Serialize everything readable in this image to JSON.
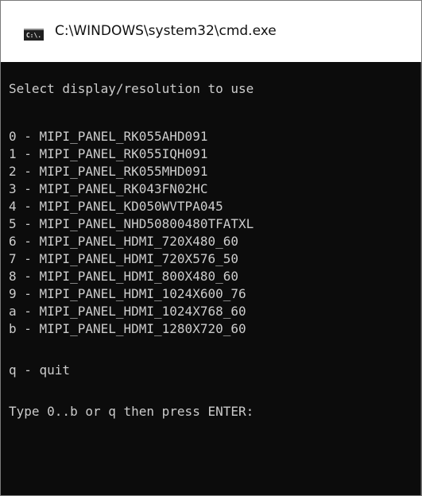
{
  "window": {
    "title": "C:\\WINDOWS\\system32\\cmd.exe",
    "icon": "cmd-icon",
    "icon_text": "C:\\."
  },
  "console": {
    "prompt_heading": "Select display/resolution to use",
    "options": [
      "0 - MIPI_PANEL_RK055AHD091",
      "1 - MIPI_PANEL_RK055IQH091",
      "2 - MIPI_PANEL_RK055MHD091",
      "3 - MIPI_PANEL_RK043FN02HC",
      "4 - MIPI_PANEL_KD050WVTPA045",
      "5 - MIPI_PANEL_NHD50800480TFATXL",
      "6 - MIPI_PANEL_HDMI_720X480_60",
      "7 - MIPI_PANEL_HDMI_720X576_50",
      "8 - MIPI_PANEL_HDMI_800X480_60",
      "9 - MIPI_PANEL_HDMI_1024X600_76",
      "a - MIPI_PANEL_HDMI_1024X768_60",
      "b - MIPI_PANEL_HDMI_1280X720_60"
    ],
    "quit_option": "q - quit",
    "input_prompt": "Type 0..b or q then press ENTER:"
  },
  "colors": {
    "console_background": "#0c0c0c",
    "console_text": "#cccccc",
    "titlebar_background": "#ffffff"
  }
}
